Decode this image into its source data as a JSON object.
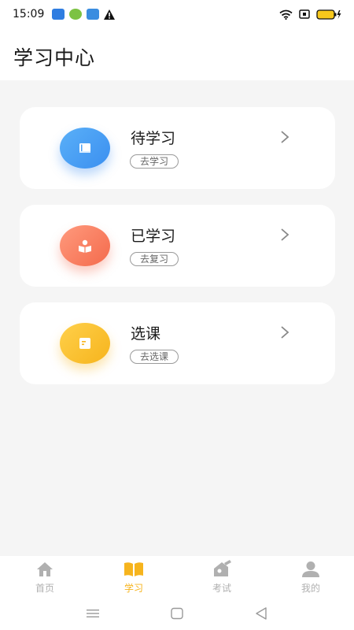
{
  "status_bar": {
    "time": "15:09"
  },
  "header": {
    "title": "学习中心"
  },
  "cards": [
    {
      "title": "待学习",
      "tag": "去学习",
      "icon": "book-icon",
      "color": "#3b8ff0"
    },
    {
      "title": "已学习",
      "tag": "去复习",
      "icon": "reader-icon",
      "color": "#f46a4c"
    },
    {
      "title": "选课",
      "tag": "去选课",
      "icon": "note-icon",
      "color": "#f6b41d"
    }
  ],
  "tabs": [
    {
      "label": "首页",
      "icon": "home-icon",
      "active": false
    },
    {
      "label": "学习",
      "icon": "open-book-icon",
      "active": true
    },
    {
      "label": "考试",
      "icon": "exam-icon",
      "active": false
    },
    {
      "label": "我的",
      "icon": "user-icon",
      "active": false
    }
  ],
  "colors": {
    "accent": "#f6b41d",
    "inactive": "#b0b0b0",
    "background": "#f5f5f5"
  }
}
